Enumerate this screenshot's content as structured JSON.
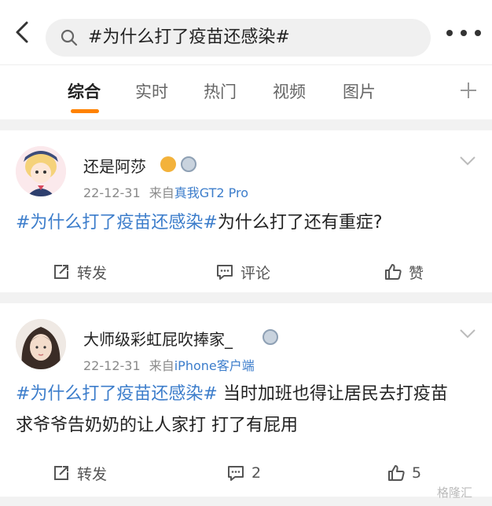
{
  "search": {
    "query": "#为什么打了疫苗还感染#"
  },
  "tabs": [
    {
      "label": "综合",
      "active": true
    },
    {
      "label": "实时"
    },
    {
      "label": "热门"
    },
    {
      "label": "视频"
    },
    {
      "label": "图片"
    }
  ],
  "colors": {
    "accent": "#ff8200",
    "link": "#3c7dcb"
  },
  "posts": [
    {
      "username": "还是阿莎",
      "date": "22-12-31",
      "from": "来自",
      "source": "真我GT2 Pro",
      "topic": "#为什么打了疫苗还感染#",
      "text": "为什么打了还有重症?",
      "repost_label": "转发",
      "comment_label": "评论",
      "like_label": "赞"
    },
    {
      "username": "大师级彩虹屁吹捧家_",
      "date": "22-12-31",
      "from": "来自",
      "source": "iPhone客户端",
      "topic": "#为什么打了疫苗还感染#",
      "text": " 当时加班也得让居民去打疫苗 求爷爷告奶奶的让人家打 打了有屁用",
      "repost_label": "转发",
      "comment_count": "2",
      "like_count": "5"
    }
  ],
  "watermark": "格隆汇"
}
